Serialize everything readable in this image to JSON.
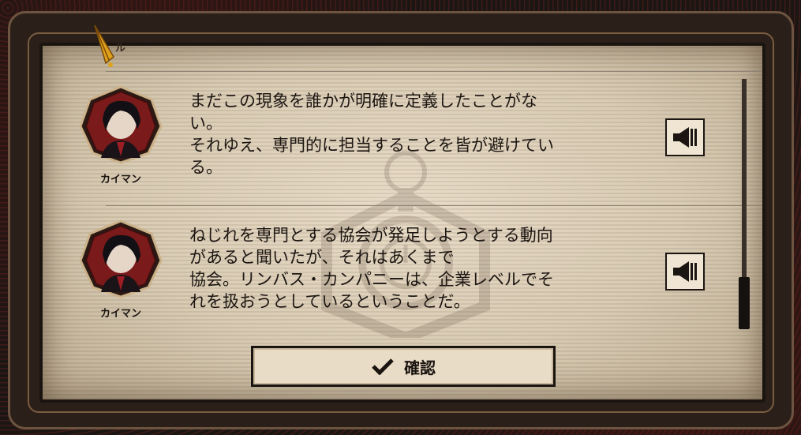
{
  "dialog": {
    "tab_label": "ル",
    "confirm_label": "確認",
    "entries": [
      {
        "speaker": "カイマン",
        "text": "まだこの現象を誰かが明確に定義したことがな\nい。\nそれゆえ、専門的に担当することを皆が避けてい\nる。"
      },
      {
        "speaker": "カイマン",
        "text": "ねじれを専門とする協会が発足しようとする動向\nがあると聞いたが、それはあくまで\n協会。リンバス・カンパニーは、企業レベルでそ\nれを扱おうとしているということだ。"
      }
    ]
  },
  "colors": {
    "paper": "#e2d5bf",
    "frame": "#6c5440",
    "ink": "#1c1612",
    "portrait_ring": "#8a1e1e"
  },
  "icons": [
    "quill-pen-icon",
    "speaker-icon",
    "checkmark-icon"
  ]
}
